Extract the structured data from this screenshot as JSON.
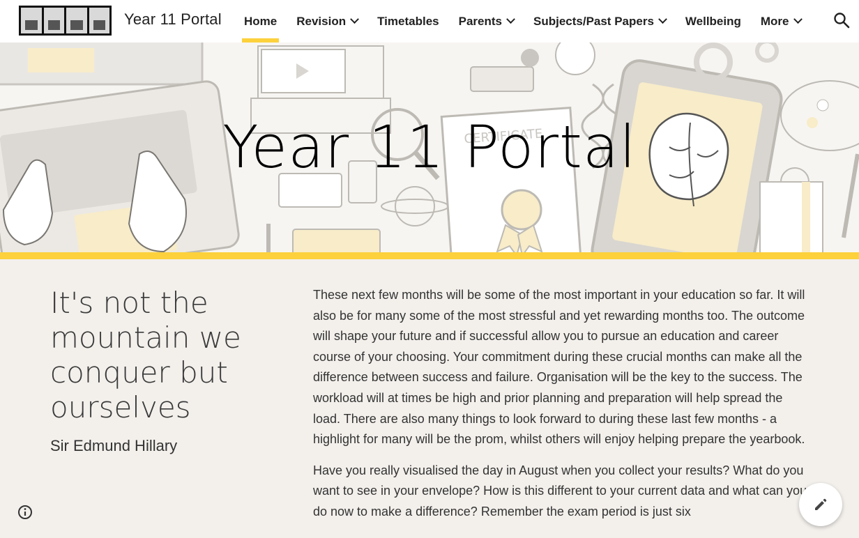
{
  "header": {
    "site_title": "Year 11 Portal",
    "nav": [
      {
        "label": "Home",
        "active": true,
        "has_menu": false
      },
      {
        "label": "Revision",
        "active": false,
        "has_menu": true
      },
      {
        "label": "Timetables",
        "active": false,
        "has_menu": false
      },
      {
        "label": "Parents",
        "active": false,
        "has_menu": true
      },
      {
        "label": "Subjects/Past Papers",
        "active": false,
        "has_menu": true
      },
      {
        "label": "Wellbeing",
        "active": false,
        "has_menu": false
      },
      {
        "label": "More",
        "active": false,
        "has_menu": true
      }
    ],
    "search_icon": "search-icon",
    "accent_color": "#fcd13c"
  },
  "hero": {
    "title": "Year 11 Portal",
    "certificate_text": "CERTIFICATE"
  },
  "content": {
    "quote": "It's not the mountain we conquer but ourselves",
    "attribution": "Sir Edmund Hillary",
    "paragraphs": [
      "These next few months will be some of the most important in your education so far. It will also be for many some of the most stressful and yet rewarding months too. The outcome will shape your future and if successful allow you to pursue an education and career course of your choosing. Your commitment during these crucial months can make all the difference between success and failure. Organisation will be the key to the success. The workload will at times be high and prior planning and preparation will help spread the load. There are also many things to look forward to during these last few months - a highlight for many will be the prom, whilst others will enjoy helping prepare the yearbook.",
      "Have you really visualised the day in August when you collect your results? What do you want to see in your envelope? How is this different to your current data and what can you do now to make a difference? Remember the exam period is just six"
    ]
  },
  "floating": {
    "info_icon": "info-icon",
    "edit_icon": "pencil-icon"
  }
}
